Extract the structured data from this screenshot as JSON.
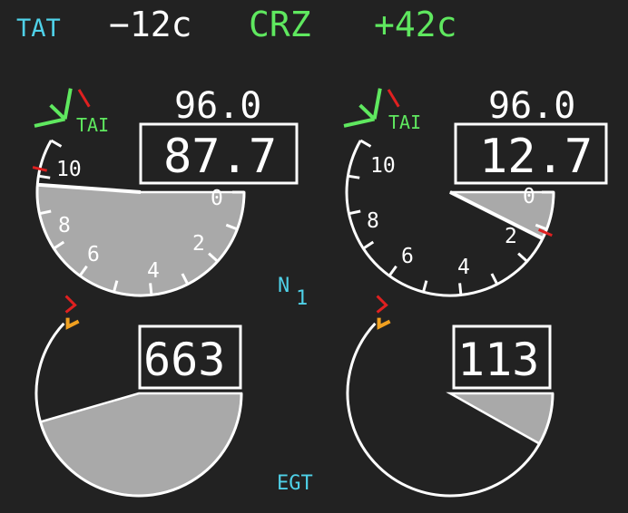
{
  "header": {
    "tat_label": "TAT",
    "tat_value": "−12c",
    "mode_label": "CRZ",
    "mode_value": "+42c"
  },
  "labels": {
    "n1": "N",
    "n1_sub": "1",
    "egt": "EGT",
    "tai_left": "TAI",
    "tai_right": "TAI"
  },
  "engines": [
    {
      "n1_target": "96.0",
      "n1_actual": "87.7",
      "n1_fraction": 0.877,
      "egt_value": "663",
      "egt_fraction": 0.78,
      "ticks": {
        "t0": "0",
        "t2": "2",
        "t4": "4",
        "t6": "6",
        "t8": "8",
        "t10": "10"
      }
    },
    {
      "n1_target": "96.0",
      "n1_actual": "12.7",
      "n1_fraction": 0.127,
      "egt_value": "113",
      "egt_fraction": 0.14,
      "ticks": {
        "t0": "0",
        "t2": "2",
        "t4": "4",
        "t6": "6",
        "t8": "8",
        "t10": "10"
      }
    }
  ],
  "colors": {
    "background": "#222222",
    "cyan": "#4fd1e8",
    "green": "#5fe85f",
    "white": "#ffffff",
    "red": "#e02020",
    "amber": "#f0a020",
    "fill": "#a9a9a9"
  }
}
